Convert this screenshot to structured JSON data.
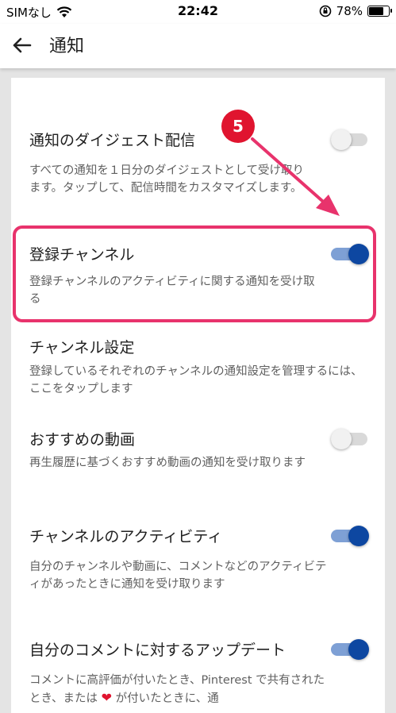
{
  "status_bar": {
    "carrier": "SIMなし",
    "time": "22:42",
    "battery": "78%",
    "battery_level": 0.78
  },
  "header": {
    "title": "通知"
  },
  "annotation": {
    "step": "5"
  },
  "settings": [
    {
      "title": "通知のダイジェスト配信",
      "desc": "すべての通知を１日分のダイジェストとして受け取ります。タップして、配信時間をカスタマイズします。",
      "toggle": "off"
    },
    {
      "title": "登録チャンネル",
      "desc": "登録チャンネルのアクティビティに関する通知を受け取る",
      "toggle": "on"
    },
    {
      "title": "チャンネル設定",
      "desc": "登録しているそれぞれのチャンネルの通知設定を管理するには、ここをタップします"
    },
    {
      "title": "おすすめの動画",
      "desc": "再生履歴に基づくおすすめ動画の通知を受け取ります",
      "toggle": "off"
    },
    {
      "title": "チャンネルのアクティビティ",
      "desc": "自分のチャンネルや動画に、コメントなどのアクティビティがあったときに通知を受け取ります",
      "toggle": "on"
    },
    {
      "title": "自分のコメントに対するアップデート",
      "desc_part1": "コメントに高評価が付いたとき、Pinterest で共有されたとき、または",
      "desc_part2": "が付いたときに、通",
      "toggle": "on"
    }
  ],
  "colors": {
    "accent": "#0d47a1",
    "highlight": "#e8336c",
    "badge": "#e0142f"
  }
}
